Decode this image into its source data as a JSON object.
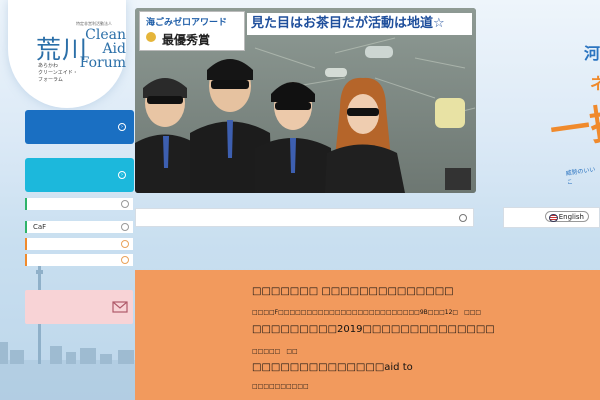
{
  "logo": {
    "kanji": "荒川",
    "english": "Clean Aid Forum",
    "english_lines": [
      "Clean",
      "Aid",
      "Forum"
    ],
    "tiny_caption": "特定非営利活動法人",
    "japanese": "あらかわ\nクリーンエイド・\nフォーラム"
  },
  "nav": {
    "caf_label": "CaF"
  },
  "banner": {
    "award_line1": "海ごみゼロアワード",
    "award_line2": "最優秀賞",
    "slogan": "見た目はお茶目だが活動は地道☆"
  },
  "right": {
    "text1": "河",
    "text2": "ネ",
    "big": "一揃",
    "small": "威勢のいいこ"
  },
  "language": {
    "label": "English"
  },
  "news": {
    "line1": "□□□□□□□ □□□□□□□□□□□□□□",
    "line2": "□□□□F□□□□□□□□□□□□□□□□□□□□□□□□□9B□□□12□　□□□",
    "line3": "□□□□□□□□□2019□□□□□□□□□□□□□□",
    "line4": "□□□□□　□□",
    "line5": "□□□□□□□□□□□□□□aid to",
    "line6": "□□□□□□□□□□"
  },
  "colors": {
    "nav_blue": "#1a6fc2",
    "nav_cyan": "#1cb8dc",
    "news_orange": "#f29a5d",
    "accent_orange": "#f08a2c",
    "brand_blue": "#2b6fa8"
  }
}
